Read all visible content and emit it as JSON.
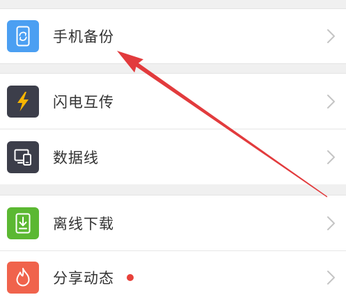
{
  "items": [
    {
      "label": "手机备份",
      "icon": "phone-backup-icon",
      "icon_bg": "#4b9ff2"
    },
    {
      "label": "闪电互传",
      "icon": "lightning-icon",
      "icon_bg": "#3c3e4a"
    },
    {
      "label": "数据线",
      "icon": "monitor-phone-icon",
      "icon_bg": "#3c3e4a"
    },
    {
      "label": "离线下载",
      "icon": "download-icon",
      "icon_bg": "#5bb832"
    },
    {
      "label": "分享动态",
      "icon": "flame-icon",
      "icon_bg": "#f0634c",
      "badge_color": "#e8413a"
    }
  ],
  "chevron_icon": "chevron-right-icon",
  "colors": {
    "background": "#f0f0f0",
    "row": "#ffffff",
    "text": "#333333",
    "chevron": "#c4c4c4",
    "lightning": "#f7b500",
    "annotation": "#e23b3d"
  }
}
